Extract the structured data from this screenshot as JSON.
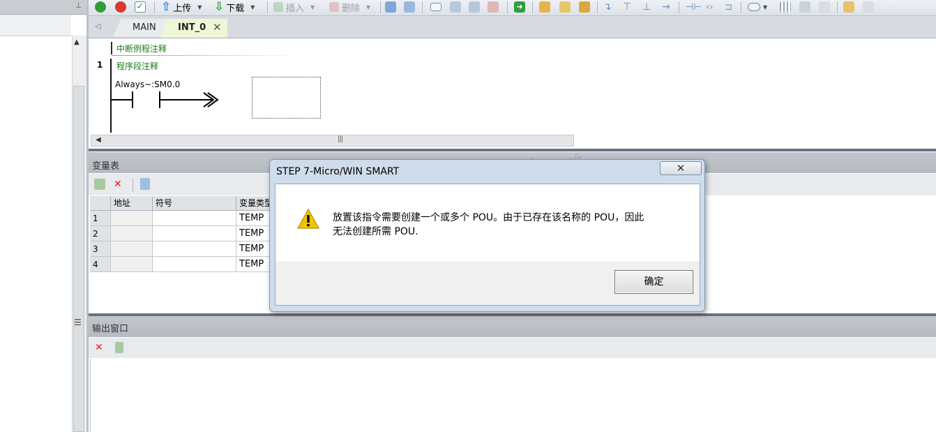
{
  "toolbar": {
    "upload_label": "上传",
    "download_label": "下载",
    "insert_label": "插入",
    "delete_label": "删除"
  },
  "tabs": [
    {
      "label": "MAIN",
      "active": false
    },
    {
      "label": "INT_0",
      "active": true,
      "close_glyph": "✕"
    }
  ],
  "editor": {
    "routine_comment": "中断例程注释",
    "network_number": "1",
    "network_comment": "程序段注释",
    "contact_label": "Always~:SM0.0"
  },
  "variable_table": {
    "title": "变量表",
    "columns": [
      "地址",
      "符号",
      "变量类型"
    ],
    "rows": [
      {
        "num": "1",
        "address": "",
        "symbol": "",
        "type": "TEMP"
      },
      {
        "num": "2",
        "address": "",
        "symbol": "",
        "type": "TEMP"
      },
      {
        "num": "3",
        "address": "",
        "symbol": "",
        "type": "TEMP"
      },
      {
        "num": "4",
        "address": "",
        "symbol": "",
        "type": "TEMP"
      }
    ]
  },
  "output_window": {
    "title": "输出窗口"
  },
  "dialog": {
    "title": "STEP 7-Micro/WIN SMART",
    "message_line1": "放置该指令需要创建一个或多个 POU。由于已存在该名称的 POU，因此",
    "message_line2": "无法创建所需 POU.",
    "ok_label": "确定",
    "close_glyph": "✕",
    "icon": "warning-icon"
  },
  "watermark": {
    "line1": "西门子工业   技术论坛",
    "line2": "support.industry.siemens.com/cs"
  },
  "colors": {
    "comment_green": "#1a7a1a",
    "warning_yellow": "#f5c400",
    "tab_active": "#eef6d8"
  }
}
